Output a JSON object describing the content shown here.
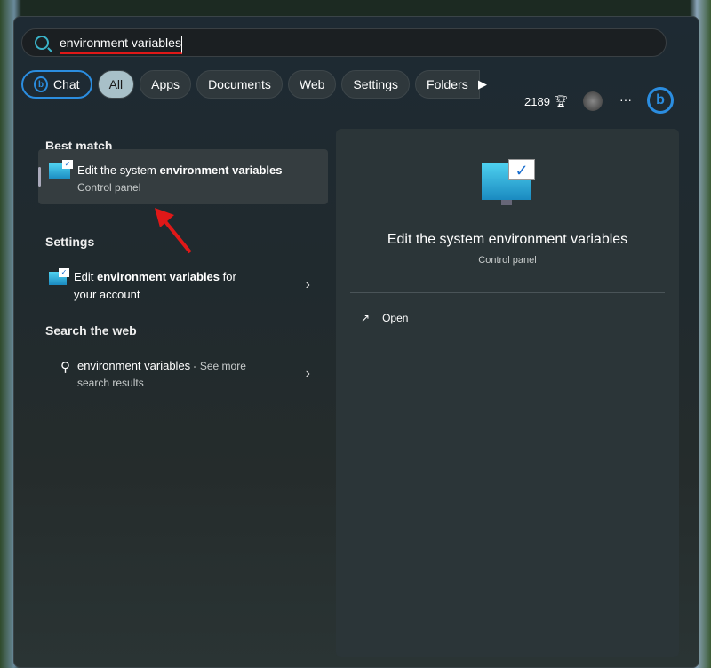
{
  "search": {
    "value": "environment variables"
  },
  "chips": [
    {
      "label": "Chat"
    },
    {
      "label": "All"
    },
    {
      "label": "Apps"
    },
    {
      "label": "Documents"
    },
    {
      "label": "Web"
    },
    {
      "label": "Settings"
    },
    {
      "label": "Folders"
    }
  ],
  "points": "2189",
  "more": "···",
  "left": {
    "best_match": "Best match",
    "best": {
      "pre": "Edit the system ",
      "bold": "environment variables",
      "sub": "Control panel"
    },
    "settings": "Settings",
    "setting_item": {
      "pre": "Edit ",
      "bold": "environment variables",
      "post": " for",
      "line2": "your account"
    },
    "web": "Search the web",
    "web_item": {
      "main": "environment variables",
      "suffix": " - See more",
      "line2": "search results"
    }
  },
  "right": {
    "title": "Edit the system environment variables",
    "sub": "Control panel",
    "open": "Open"
  },
  "colors": {
    "accent": "#2b8de0",
    "annotation": "#e01818"
  }
}
